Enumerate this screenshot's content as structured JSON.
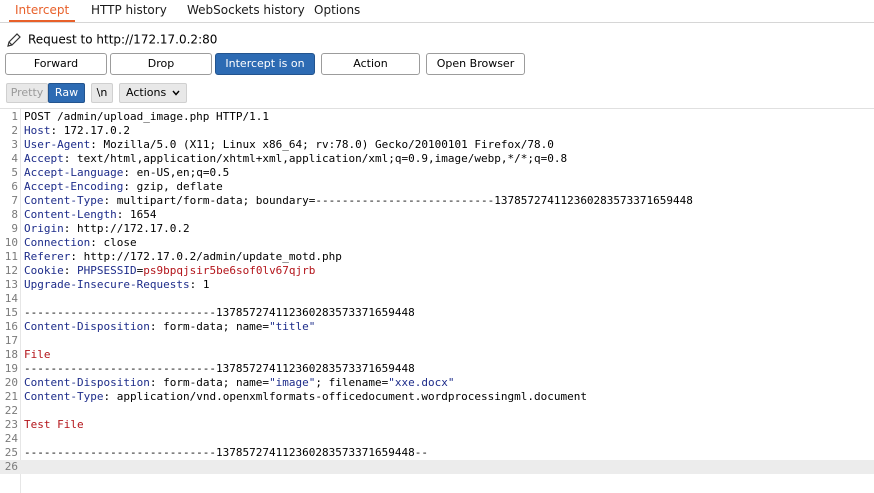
{
  "tabs": [
    "Intercept",
    "HTTP history",
    "WebSockets history",
    "Options"
  ],
  "request_label": "Request to http://172.17.0.2:80",
  "buttons": {
    "forward": "Forward",
    "drop": "Drop",
    "intercept": "Intercept is on",
    "action": "Action",
    "open_browser": "Open Browser"
  },
  "view": {
    "pretty": "Pretty",
    "raw": "Raw",
    "newline": "\\n",
    "actions": "Actions"
  },
  "colors": {
    "accent": "#e8602a",
    "primary_button": "#2d6bb3",
    "header_name": "#1d2c8a",
    "value_red": "#b3141a"
  },
  "lines": [
    {
      "n": "1",
      "text": "POST /admin/upload_image.php HTTP/1.1"
    },
    {
      "n": "2",
      "name": "Host",
      "value": "172.17.0.2"
    },
    {
      "n": "3",
      "name": "User-Agent",
      "value": "Mozilla/5.0 (X11; Linux x86_64; rv:78.0) Gecko/20100101 Firefox/78.0"
    },
    {
      "n": "4",
      "name": "Accept",
      "value": "text/html,application/xhtml+xml,application/xml;q=0.9,image/webp,*/*;q=0.8"
    },
    {
      "n": "5",
      "name": "Accept-Language",
      "value": "en-US,en;q=0.5"
    },
    {
      "n": "6",
      "name": "Accept-Encoding",
      "value": "gzip, deflate"
    },
    {
      "n": "7",
      "name": "Content-Type",
      "value": "multipart/form-data; boundary=---------------------------137857274112360283573371659448"
    },
    {
      "n": "8",
      "name": "Content-Length",
      "value": "1654"
    },
    {
      "n": "9",
      "name": "Origin",
      "value": "http://172.17.0.2"
    },
    {
      "n": "10",
      "name": "Connection",
      "value": "close"
    },
    {
      "n": "11",
      "name": "Referer",
      "value": "http://172.17.0.2/admin/update_motd.php"
    },
    {
      "n": "12",
      "name": "Cookie",
      "cookie_name": "PHPSESSID",
      "cookie_value": "ps9bpqjsir5be6sof0lv67qjrb"
    },
    {
      "n": "13",
      "name": "Upgrade-Insecure-Requests",
      "value": "1"
    },
    {
      "n": "14",
      "text": ""
    },
    {
      "n": "15",
      "text": "-----------------------------137857274112360283573371659448"
    },
    {
      "n": "16",
      "name": "Content-Disposition",
      "value": "form-data; name=",
      "quoted": "\"title\""
    },
    {
      "n": "17",
      "text": ""
    },
    {
      "n": "18",
      "body": "File"
    },
    {
      "n": "19",
      "text": "-----------------------------137857274112360283573371659448"
    },
    {
      "n": "20",
      "name": "Content-Disposition",
      "value": "form-data; name=",
      "quoted": "\"image\"",
      "value2": "; filename=",
      "quoted2": "\"xxe.docx\""
    },
    {
      "n": "21",
      "name": "Content-Type",
      "value": "application/vnd.openxmlformats-officedocument.wordprocessingml.document"
    },
    {
      "n": "22",
      "text": ""
    },
    {
      "n": "23",
      "body": "Test File"
    },
    {
      "n": "24",
      "text": ""
    },
    {
      "n": "25",
      "text": "-----------------------------137857274112360283573371659448--"
    },
    {
      "n": "26",
      "text": ""
    }
  ]
}
